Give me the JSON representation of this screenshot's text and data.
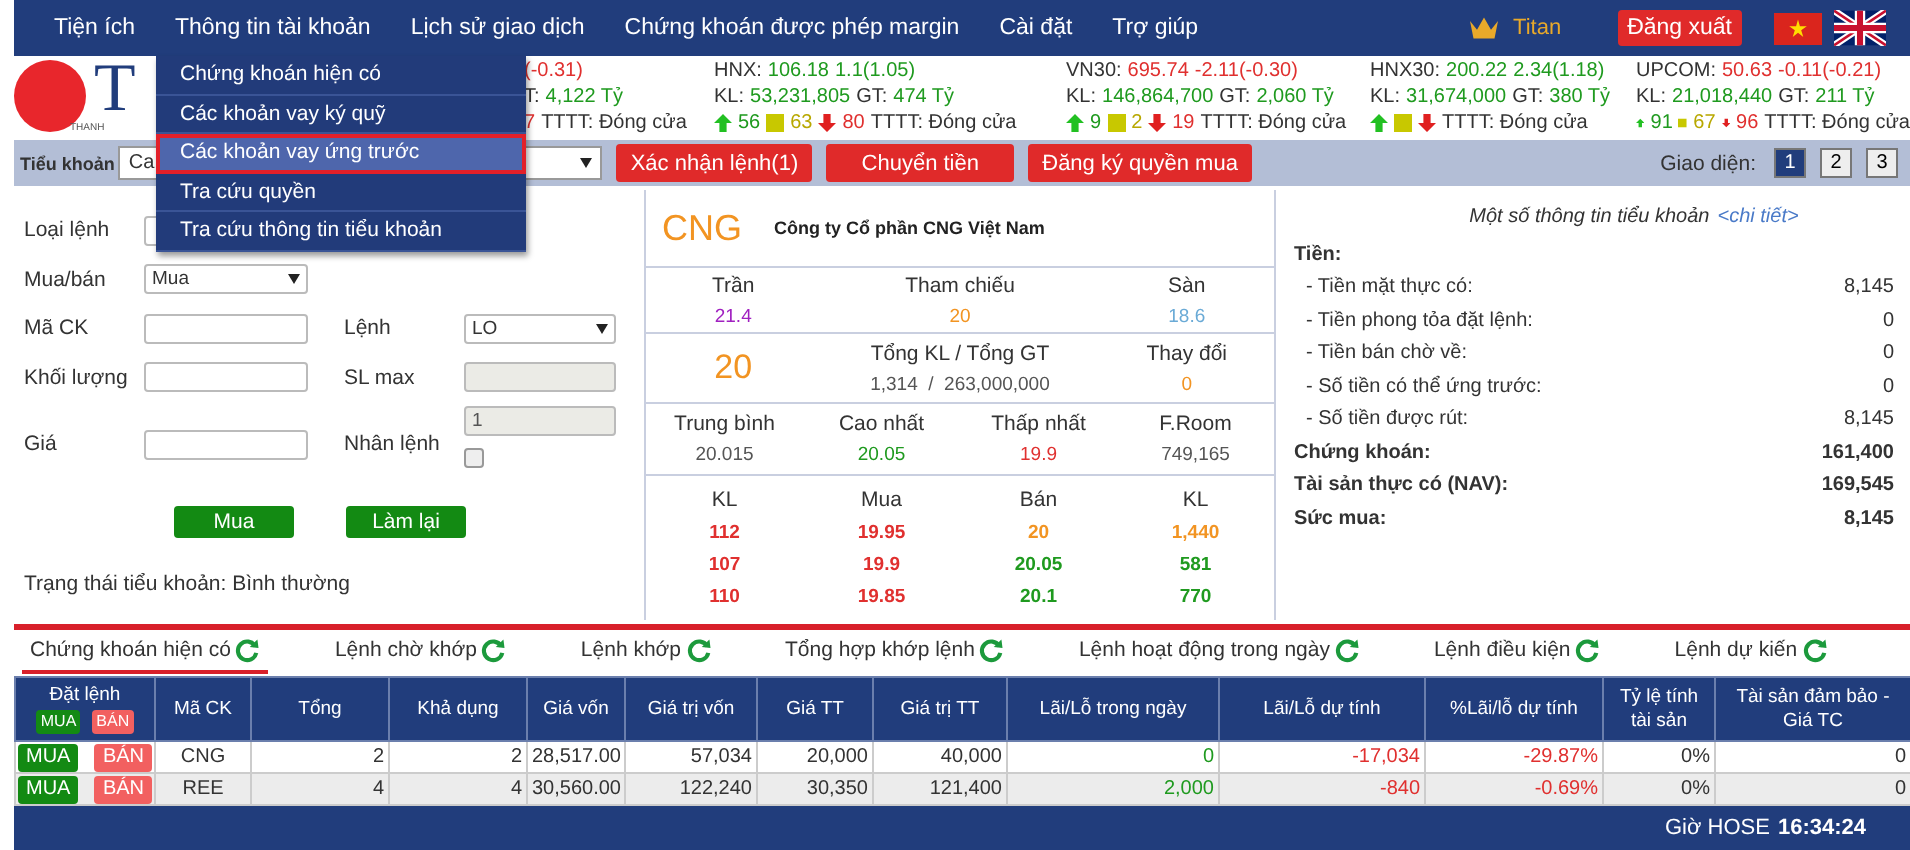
{
  "nav": {
    "items": [
      "Tiện ích",
      "Thông tin tài khoản",
      "Lịch sử giao dịch",
      "Chứng khoán được phép margin",
      "Cài đặt",
      "Trợ giúp"
    ],
    "user": "Titan",
    "logout": "Đăng xuất"
  },
  "menu": {
    "items": [
      {
        "label": "Chứng khoán hiện có",
        "selected": false
      },
      {
        "label": "Các khoản vay ký quỹ",
        "selected": false
      },
      {
        "label": "Các khoản vay ứng trước",
        "selected": true
      },
      {
        "label": "Tra cứu quyền",
        "selected": false
      },
      {
        "label": "Tra cứu thông tin tiểu khoản",
        "selected": false
      }
    ]
  },
  "logo": {
    "mark": "T",
    "tagline": "THANH"
  },
  "indices": [
    {
      "lines": [
        [
          {
            "kind": "text",
            "text": "(-0.31)",
            "color": "#e0302f"
          }
        ],
        [
          {
            "kind": "text",
            "text": "T:",
            "color": "#333333"
          },
          {
            "kind": "text",
            "text": "4,122 Tỷ",
            "color": "#1f9a1f"
          }
        ],
        [
          {
            "kind": "text",
            "text": "7",
            "color": "#e0302f"
          },
          {
            "kind": "text",
            "text": "TTTT: Đóng cửa",
            "color": "#333333"
          }
        ]
      ]
    },
    {
      "lines": [
        [
          {
            "kind": "text",
            "text": "HNX:",
            "color": "#333333"
          },
          {
            "kind": "text",
            "text": "106.18",
            "color": "#1f9a1f"
          },
          {
            "kind": "text",
            "text": "1.1(1.05)",
            "color": "#1f9a1f"
          }
        ],
        [
          {
            "kind": "text",
            "text": "KL:",
            "color": "#333333"
          },
          {
            "kind": "text",
            "text": "53,231,805",
            "color": "#1f9a1f"
          },
          {
            "kind": "text",
            "text": "GT:",
            "color": "#333333"
          },
          {
            "kind": "text",
            "text": "474 Tỷ",
            "color": "#1f9a1f"
          }
        ],
        [
          {
            "kind": "up"
          },
          {
            "kind": "text",
            "text": "56",
            "color": "#1f9a1f"
          },
          {
            "kind": "flat"
          },
          {
            "kind": "text",
            "text": "63",
            "color": "#b8a800"
          },
          {
            "kind": "down"
          },
          {
            "kind": "text",
            "text": "80",
            "color": "#e0302f"
          },
          {
            "kind": "text",
            "text": "TTTT: Đóng cửa",
            "color": "#333333"
          }
        ]
      ]
    },
    {
      "lines": [
        [
          {
            "kind": "text",
            "text": "VN30:",
            "color": "#333333"
          },
          {
            "kind": "text",
            "text": "695.74",
            "color": "#e0302f"
          },
          {
            "kind": "text",
            "text": "-2.11(-0.30)",
            "color": "#e0302f"
          }
        ],
        [
          {
            "kind": "text",
            "text": "KL:",
            "color": "#333333"
          },
          {
            "kind": "text",
            "text": "146,864,700",
            "color": "#1f9a1f"
          },
          {
            "kind": "text",
            "text": "GT:",
            "color": "#333333"
          },
          {
            "kind": "text",
            "text": "2,060 Tỷ",
            "color": "#1f9a1f"
          }
        ],
        [
          {
            "kind": "up"
          },
          {
            "kind": "text",
            "text": "9",
            "color": "#1f9a1f"
          },
          {
            "kind": "flat"
          },
          {
            "kind": "text",
            "text": "2",
            "color": "#b8a800"
          },
          {
            "kind": "down"
          },
          {
            "kind": "text",
            "text": "19",
            "color": "#e0302f"
          },
          {
            "kind": "text",
            "text": "TTTT: Đóng cửa",
            "color": "#333333"
          }
        ]
      ]
    },
    {
      "lines": [
        [
          {
            "kind": "text",
            "text": "HNX30:",
            "color": "#333333"
          },
          {
            "kind": "text",
            "text": "200.22",
            "color": "#1f9a1f"
          },
          {
            "kind": "text",
            "text": "2.34(1.18)",
            "color": "#1f9a1f"
          }
        ],
        [
          {
            "kind": "text",
            "text": "KL:",
            "color": "#333333"
          },
          {
            "kind": "text",
            "text": "31,674,000",
            "color": "#1f9a1f"
          },
          {
            "kind": "text",
            "text": "GT:",
            "color": "#333333"
          },
          {
            "kind": "text",
            "text": "380 Tỷ",
            "color": "#1f9a1f"
          }
        ],
        [
          {
            "kind": "up"
          },
          {
            "kind": "flat"
          },
          {
            "kind": "down"
          },
          {
            "kind": "text",
            "text": "TTTT: Đóng cửa",
            "color": "#333333"
          }
        ]
      ]
    },
    {
      "lines": [
        [
          {
            "kind": "text",
            "text": "UPCOM:",
            "color": "#333333"
          },
          {
            "kind": "text",
            "text": "50.63",
            "color": "#e0302f"
          },
          {
            "kind": "text",
            "text": "-0.11(-0.21)",
            "color": "#e0302f"
          }
        ],
        [
          {
            "kind": "text",
            "text": "KL:",
            "color": "#333333"
          },
          {
            "kind": "text",
            "text": "21,018,440",
            "color": "#1f9a1f"
          },
          {
            "kind": "text",
            "text": "GT:",
            "color": "#333333"
          },
          {
            "kind": "text",
            "text": "211 Tỷ",
            "color": "#1f9a1f"
          }
        ],
        [
          {
            "kind": "up"
          },
          {
            "kind": "text",
            "text": "91",
            "color": "#1f9a1f"
          },
          {
            "kind": "flat"
          },
          {
            "kind": "text",
            "text": "67",
            "color": "#b8a800"
          },
          {
            "kind": "down"
          },
          {
            "kind": "text",
            "text": "96",
            "color": "#e0302f"
          },
          {
            "kind": "text",
            "text": "TTTT: Đóng cửa",
            "color": "#333333"
          }
        ]
      ]
    }
  ],
  "toolbar": {
    "account_label": "Tiểu khoản",
    "account_value": "Ca",
    "actions": [
      "Xác nhận lệnh(1)",
      "Chuyển tiền",
      "Đăng ký quyền mua"
    ],
    "layout_label": "Giao diện:",
    "layouts": [
      {
        "label": "1",
        "selected": true
      },
      {
        "label": "2",
        "selected": false
      },
      {
        "label": "3",
        "selected": false
      }
    ]
  },
  "form": {
    "rows": [
      {
        "left": {
          "label": "Loại lệnh",
          "kind": "select",
          "disabled": false
        }
      },
      {
        "left": {
          "label": "Mua/bán",
          "kind": "select",
          "value": "Mua",
          "disabled": false
        }
      },
      {
        "left": {
          "label": "Mã CK",
          "kind": "input",
          "disabled": false
        },
        "right": {
          "label": "Lệnh",
          "kind": "select",
          "value": "LO",
          "disabled": false
        }
      },
      {
        "left": {
          "label": "Khối lượng",
          "kind": "input",
          "disabled": false
        },
        "right": {
          "label": "SL max",
          "kind": "input",
          "disabled": true
        }
      },
      {
        "left": {
          "label": "Giá",
          "kind": "input",
          "disabled": false
        },
        "right": {
          "label": "Nhân lệnh",
          "kind": "multiplier",
          "value": "1",
          "disabled": true,
          "checked": false
        }
      }
    ],
    "buttons": [
      "Mua",
      "Làm lại"
    ],
    "status": "Trạng thái tiểu khoản: Bình thường"
  },
  "stock": {
    "symbol": "CNG",
    "company": "Công ty Cổ phần CNG Việt Nam",
    "limits": [
      {
        "label": "Trần",
        "value": "21.4",
        "color": "#a020c0"
      },
      {
        "label": "Tham chiếu",
        "value": "20",
        "color": "#f29422"
      },
      {
        "label": "Sàn",
        "value": "18.6",
        "color": "#6aaad6"
      }
    ],
    "price": "20",
    "summary": [
      {
        "label": "Tổng KL / Tổng GT",
        "value": "1,314  /  263,000,000",
        "color": "#555555"
      },
      {
        "label": "Thay đổi",
        "value": "0",
        "color": "#f29422"
      }
    ],
    "stats": [
      {
        "label": "Trung bình",
        "value": "20.015",
        "color": "#555555"
      },
      {
        "label": "Cao nhất",
        "value": "20.05",
        "color": "#1f9a1f"
      },
      {
        "label": "Thấp nhất",
        "value": "19.9",
        "color": "#e0302f"
      },
      {
        "label": "F.Room",
        "value": "749,165",
        "color": "#555555"
      }
    ],
    "book": {
      "columns": [
        "KL",
        "Mua",
        "Bán",
        "KL"
      ],
      "rows": [
        [
          {
            "text": "112",
            "color": "#e0302f"
          },
          {
            "text": "19.95",
            "color": "#e0302f"
          },
          {
            "text": "20",
            "color": "#f29422"
          },
          {
            "text": "1,440",
            "color": "#f29422"
          }
        ],
        [
          {
            "text": "107",
            "color": "#e0302f"
          },
          {
            "text": "19.9",
            "color": "#e0302f"
          },
          {
            "text": "20.05",
            "color": "#1f9a1f"
          },
          {
            "text": "581",
            "color": "#1f9a1f"
          }
        ],
        [
          {
            "text": "110",
            "color": "#e0302f"
          },
          {
            "text": "19.85",
            "color": "#e0302f"
          },
          {
            "text": "20.1",
            "color": "#1f9a1f"
          },
          {
            "text": "770",
            "color": "#1f9a1f"
          }
        ]
      ]
    }
  },
  "account": {
    "title": "Một số thông tin tiểu khoản",
    "link": "<chi tiết>",
    "rows": [
      {
        "kind": "heading",
        "label": "Tiền:"
      },
      {
        "kind": "item",
        "label": "- Tiền mặt thực có:",
        "value": "8,145"
      },
      {
        "kind": "item",
        "label": "- Tiền phong tỏa đặt lệnh:",
        "value": "0"
      },
      {
        "kind": "item",
        "label": "- Tiền bán chờ về:",
        "value": "0"
      },
      {
        "kind": "item",
        "label": "- Số tiền có thể ứng trước:",
        "value": "0"
      },
      {
        "kind": "item",
        "label": "- Số tiền được rút:",
        "value": "8,145"
      },
      {
        "kind": "total",
        "label": "Chứng khoán:",
        "value": "161,400"
      },
      {
        "kind": "total",
        "label": "Tài sản thực có (NAV):",
        "value": "169,545"
      },
      {
        "kind": "total",
        "label": "Sức mua:",
        "value": "8,145"
      }
    ]
  },
  "tabs": [
    {
      "label": "Chứng khoán hiện có",
      "selected": true
    },
    {
      "label": "Lệnh chờ khớp",
      "selected": false
    },
    {
      "label": "Lệnh khớp",
      "selected": false
    },
    {
      "label": "Tổng hợp khớp lệnh",
      "selected": false
    },
    {
      "label": "Lệnh hoạt động trong ngày",
      "selected": false
    },
    {
      "label": "Lệnh điều kiện",
      "selected": false
    },
    {
      "label": "Lệnh dự kiến",
      "selected": false
    }
  ],
  "table": {
    "order_column": {
      "label": "Đặt lệnh",
      "buy": "MUA",
      "sell": "BÁN"
    },
    "columns": [
      "Mã CK",
      "Tổng",
      "Khả dụng",
      "Giá vốn",
      "Giá trị vốn",
      "Giá TT",
      "Giá trị TT",
      "Lãi/Lỗ trong ngày",
      "Lãi/Lỗ dự tính",
      "%Lãi/lỗ dự tính",
      "Tỷ lệ tính tài sản",
      "Tài sản đảm bảo - Giá TC"
    ],
    "rows": [
      {
        "buy": "MUA",
        "sell": "BÁN",
        "cells": [
          {
            "text": "CNG",
            "color": "#333333"
          },
          {
            "text": "2",
            "color": "#333333"
          },
          {
            "text": "2",
            "color": "#333333"
          },
          {
            "text": "28,517.00",
            "color": "#333333"
          },
          {
            "text": "57,034",
            "color": "#333333"
          },
          {
            "text": "20,000",
            "color": "#333333"
          },
          {
            "text": "40,000",
            "color": "#333333"
          },
          {
            "text": "0",
            "color": "#1f9a1f"
          },
          {
            "text": "-17,034",
            "color": "#e0302f"
          },
          {
            "text": "-29.87%",
            "color": "#e0302f"
          },
          {
            "text": "0%",
            "color": "#333333"
          },
          {
            "text": "0",
            "color": "#333333"
          }
        ]
      },
      {
        "buy": "MUA",
        "sell": "BÁN",
        "cells": [
          {
            "text": "REE",
            "color": "#333333"
          },
          {
            "text": "4",
            "color": "#333333"
          },
          {
            "text": "4",
            "color": "#333333"
          },
          {
            "text": "30,560.00",
            "color": "#333333"
          },
          {
            "text": "122,240",
            "color": "#333333"
          },
          {
            "text": "30,350",
            "color": "#333333"
          },
          {
            "text": "121,400",
            "color": "#333333"
          },
          {
            "text": "2,000",
            "color": "#1f9a1f"
          },
          {
            "text": "-840",
            "color": "#e0302f"
          },
          {
            "text": "-0.69%",
            "color": "#e0302f"
          },
          {
            "text": "0%",
            "color": "#333333"
          },
          {
            "text": "0",
            "color": "#333333"
          }
        ]
      }
    ]
  },
  "footer": {
    "clock_label": "Giờ HOSE",
    "clock": "16:34:24"
  }
}
